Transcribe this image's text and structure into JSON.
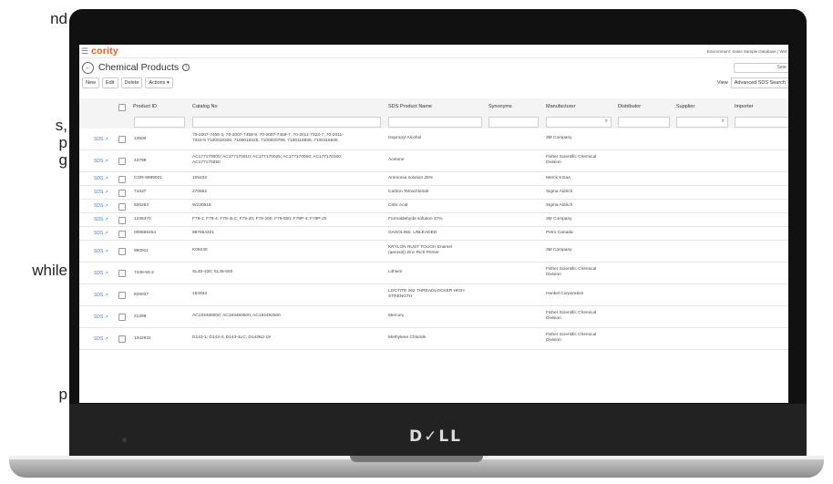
{
  "side_text": [
    "nd",
    "s,",
    "p",
    "g",
    "while",
    "p"
  ],
  "laptop": {
    "logo": "D✓LL"
  },
  "app": {
    "brand": "cority",
    "environment": "Environment: Sales Sample Database | Wel",
    "page_title": "Chemical Products",
    "search_placeholder": "Sear",
    "toolbar": {
      "new": "New",
      "edit": "Edit",
      "delete": "Delete",
      "actions": "Actions ▾",
      "view_label": "View",
      "view_value": "Advanced SDS Search"
    },
    "columns": [
      "Product ID",
      "Catalog No",
      "SDS Product Name",
      "Synonyms",
      "Manufacturer",
      "Distributor",
      "Supplier",
      "Importer"
    ],
    "sds_label": "SDS",
    "rows": [
      {
        "id": "13506",
        "catalog": [
          "70-2007-7456-3, 70-2007-7458-9, 70-2007-7459-7, 70-2011-7323-7, 70-2011-",
          "7324-5 7100018326, 7100018325, 7100020799, 7100115636, 7100115635"
        ],
        "name": [
          "Isopropyl Alcohol"
        ],
        "manufacturer": [
          "3M Company"
        ]
      },
      {
        "id": "43798",
        "catalog": [
          "AC177170000; AC177170010; AC177170025; AC177170050; AC177170100;",
          "AC177170250"
        ],
        "name": [
          "Acetone"
        ],
        "manufacturer": [
          "Fisher Scientific Chemical",
          "Division"
        ]
      },
      {
        "id": "COR-9999001",
        "catalog": [
          "105432"
        ],
        "name": [
          "Ammonia solution 25%"
        ],
        "manufacturer": [
          "Merck KGaA"
        ]
      },
      {
        "id": "71637",
        "catalog": [
          "270652"
        ],
        "name": [
          "Carbon Tetrachloride"
        ],
        "manufacturer": [
          "Sigma Aldrich"
        ]
      },
      {
        "id": "826263",
        "catalog": [
          "W230618"
        ],
        "name": [
          "Citric Acid"
        ],
        "manufacturer": [
          "Sigma Aldrich"
        ]
      },
      {
        "id": "1235370",
        "catalog": [
          "F79-1; F79-4; F79-4LC; F79-20; F79-200; F79-500; F79P-4; F79P-20"
        ],
        "name": [
          "Formaldehyde solution 37%"
        ],
        "manufacturer": [
          "3M Company"
        ]
      },
      {
        "id": "008565454",
        "catalog": [
          "987654321"
        ],
        "name": [
          "GASOLINE, UNLEADED"
        ],
        "manufacturer": [
          "Petro Canada"
        ]
      },
      {
        "id": "980911",
        "catalog": [
          "K09240"
        ],
        "name": [
          "KRYLON RUST TOUGH Enamel",
          "(aerosol) Zinc Rich Primer"
        ],
        "manufacturer": [
          "3M Company"
        ]
      },
      {
        "id": "7439-93-2",
        "catalog": [
          "SL45-100; SL45-500"
        ],
        "name": [
          "Lithium"
        ],
        "manufacturer": [
          "Fisher Scientific Chemical",
          "Division"
        ]
      },
      {
        "id": "826037",
        "catalog": [
          "153483"
        ],
        "name": [
          "LOCTITE 262 THREADLOCKER HIGH",
          "STRENGTH"
        ],
        "manufacturer": [
          "Henkel Corporation"
        ]
      },
      {
        "id": "21299",
        "catalog": [
          "AC193480000; AC193480500; AC193482500"
        ],
        "name": [
          "Mercury"
        ],
        "manufacturer": [
          "Fisher Scientific Chemical",
          "Division"
        ]
      },
      {
        "id": "1342931",
        "catalog": [
          "D143-1; D143-4; D143-4LC; D143N2-19"
        ],
        "name": [
          "Methylene Chloride"
        ],
        "manufacturer": [
          "Fisher Scientific Chemical",
          "Division"
        ]
      }
    ]
  },
  "colors": {
    "brand": "#e85b1e",
    "link": "#3a7ad6"
  }
}
